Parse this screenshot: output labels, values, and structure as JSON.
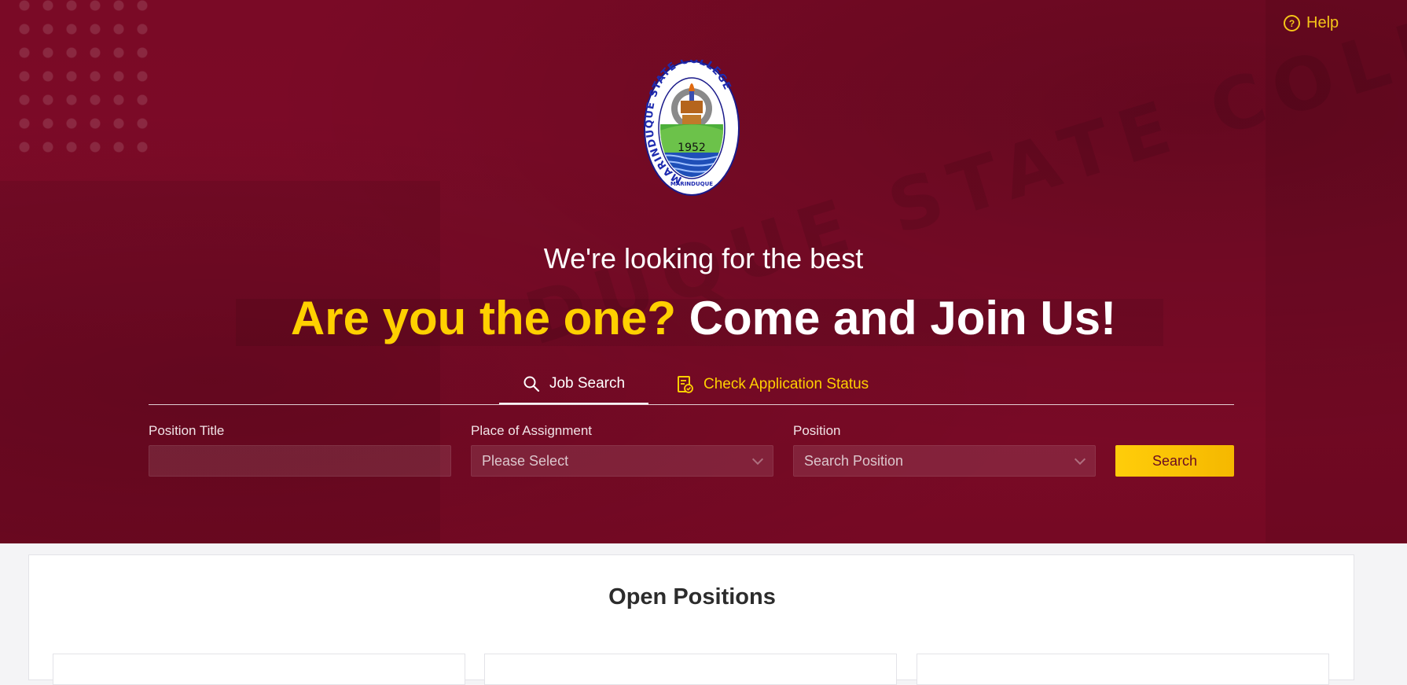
{
  "header": {
    "help_label": "Help",
    "help_icon": "help-circle-icon"
  },
  "logo": {
    "ring_text": "MARINDUQUE STATE COLLEGE",
    "year": "1952",
    "bottom_text": "MARINDUQUE"
  },
  "hero": {
    "tagline": "We're looking for the best",
    "headline_highlight": "Are you the one?",
    "headline_rest": "Come and Join Us!"
  },
  "tabs": [
    {
      "label": "Job Search",
      "icon": "search-icon",
      "active": true
    },
    {
      "label": "Check Application Status",
      "icon": "document-check-icon",
      "active": false
    }
  ],
  "search_form": {
    "position_title": {
      "label": "Position Title",
      "value": "",
      "placeholder": ""
    },
    "place_of_assignment": {
      "label": "Place of Assignment",
      "selected": "Please Select"
    },
    "position": {
      "label": "Position",
      "selected": "Search Position"
    },
    "search_button": "Search"
  },
  "open_positions": {
    "title": "Open Positions"
  },
  "colors": {
    "brand_maroon": "#7a0a26",
    "accent_yellow": "#ffd000",
    "button_yellow": "#ffcd0a"
  }
}
